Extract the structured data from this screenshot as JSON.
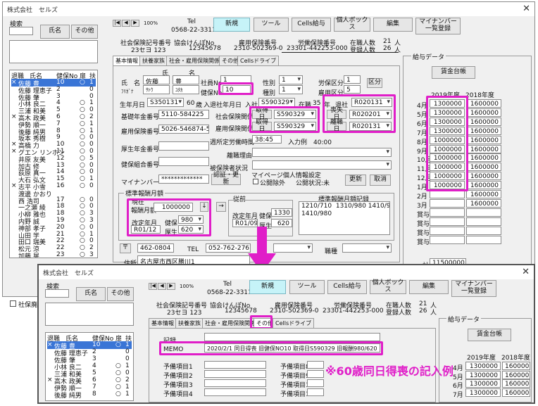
{
  "window": {
    "title": "株式会社　セルズ",
    "close_glyph": "✕"
  },
  "search": {
    "label": "検索",
    "name_button": "氏名",
    "other_button": "その他"
  },
  "nav": {
    "first": "|◀",
    "prev": "◀",
    "next": "▶",
    "last": "▶|",
    "zoom": "100%"
  },
  "tel": {
    "label": "Tel",
    "value": "0568-22-3311"
  },
  "toolbar": {
    "new": "新規",
    "tools": "ツール",
    "cells_payroll": "Cells給与",
    "personal_box": "個人ボックス",
    "edit": "編集",
    "mynumber": "マイナンバー\n一覧登録"
  },
  "insurance": {
    "social_no_label": "社会保険記号番号",
    "social_no": "23セヨ 123",
    "kyokai_label": "協会けんぽNo",
    "kyokai_no": "12345678",
    "employment_label": "雇用保険番号",
    "employment_no": "2310-502369-0",
    "labor_label": "労働保険番号",
    "labor_no": "23301-442253-000",
    "enrolled_label": "在職人数",
    "enrolled": "21",
    "registered_label": "登録人数",
    "registered": "26",
    "unit": "人"
  },
  "employee_list": {
    "headers": [
      "退職",
      "氏名",
      "健保No",
      "扉",
      "扶"
    ],
    "rows": [
      [
        "×",
        "佐藤 豊",
        "10",
        "○",
        "1"
      ],
      [
        "",
        "佐藤 理恵子",
        "2",
        "",
        "0"
      ],
      [
        "",
        "佐藤 肇",
        "3",
        "",
        "0"
      ],
      [
        "",
        "小林 良二",
        "4",
        "○",
        "1"
      ],
      [
        "",
        "三浦 和美",
        "5",
        "○",
        "0"
      ],
      [
        "×",
        "高木 政美",
        "6",
        "○",
        "2"
      ],
      [
        "",
        "伊勢 順一",
        "7",
        "○",
        "1"
      ],
      [
        "",
        "後藤 純男",
        "8",
        "○",
        "1"
      ],
      [
        "",
        "坂本 秀樹",
        "9",
        "○",
        "0"
      ],
      [
        "×",
        "高橋 力",
        "10",
        "○",
        "0"
      ],
      [
        "×",
        "グエン リンホン",
        "11",
        "○",
        "0"
      ],
      [
        "",
        "井原 友美",
        "12",
        "○",
        "5"
      ],
      [
        "",
        "加古 修",
        "13",
        "○",
        "0"
      ],
      [
        "",
        "荻原 真一",
        "14",
        "○",
        "0"
      ],
      [
        "",
        "大石 弘文",
        "15",
        "○",
        "1"
      ],
      [
        "×",
        "志平 小雪",
        "16",
        "○",
        "0"
      ],
      [
        "",
        "渡邊 かおり",
        "",
        "",
        ""
      ],
      [
        "",
        "西 浩司",
        "17",
        "○",
        "0"
      ],
      [
        "",
        "一之瀬 綾",
        "18",
        "○",
        "0"
      ],
      [
        "",
        "小柳 雅也",
        "18",
        "○",
        "3"
      ],
      [
        "",
        "内野 誠",
        "19",
        "○",
        "3"
      ],
      [
        "",
        "神部 孝子",
        "20",
        "○",
        "0"
      ],
      [
        "",
        "山田 学",
        "21",
        "○",
        "1"
      ],
      [
        "",
        "田口 瑞美",
        "22",
        "○",
        "0"
      ],
      [
        "",
        "松元 涼",
        "22",
        "○",
        "2"
      ],
      [
        "",
        "加藤 晃",
        "23",
        "○",
        "3"
      ]
    ],
    "retired_checkbox": "社保廃止"
  },
  "tabs1": [
    "基本情報",
    "扶養家族",
    "社会・雇用保険関係",
    "その他",
    "Cellsドライブ"
  ],
  "basic": {
    "name_label": "氏　名",
    "surname_header": "氏",
    "given_header": "名",
    "surname": "佐藤",
    "given": "豊",
    "furigana_label": "ﾌﾘｶﾞﾅ",
    "furi_surname": "ｻﾄｳ",
    "furi_given": "ﾕﾀｶ",
    "emp_no_label": "社員No",
    "emp_no": "1",
    "kenpo_no_label": "健保No",
    "kenpo_no": "10",
    "sex_label": "性別",
    "sex": "1",
    "kind_label": "種別",
    "kind": "1",
    "rouho_label": "労保区分",
    "rouho": "1",
    "koho_label": "雇用区分",
    "koho": "5",
    "kubun_button": "区分",
    "birth_label": "生年月日",
    "birth": "S350131",
    "age": "60",
    "age_unit": "歳",
    "join_label": "入退社年月日",
    "join_in": "入社",
    "join": "S590329",
    "tenure_label": "在職",
    "tenure": "35",
    "tenure_unit": "年",
    "retire_label": "退社",
    "retire": "R020131",
    "pension_label": "基礎年金番号",
    "pension": "5110-584225",
    "shakai_label": "社会保険関係",
    "acquire_button": "取得日",
    "shakai_acquire": "S590329",
    "loss_button": "喪失日",
    "shakai_loss": "R020201",
    "koyou_ins_label": "雇用保険関係",
    "koyou_acquire": "S590329",
    "leave_button": "離職日",
    "koyou_leave": "R020131",
    "koyou_no_label": "雇用保険番号",
    "koyou_no": "5026-546874-5",
    "weekly_label": "週所定労働時間",
    "weekly": "38:45",
    "input_example": "入力例　40:00",
    "kousei_label": "厚生年金番号",
    "kousei": "",
    "rishoku_reason_label": "離職理由",
    "kenpo_kumiai_label": "健保組合番号",
    "hihoken_label": "被保険者状況",
    "mynumber_label": "マイナンバー",
    "mynumber_mask": "*************",
    "cert_button": "認証・更新",
    "mynumber_setting_label": "マイページ個人情報設定",
    "public_exclude": "公開除外",
    "public_status": "公開状況:未",
    "update_button": "更新",
    "cancel_button": "取消"
  },
  "standard": {
    "section_label": "標準報酬月額",
    "current_label": "現在",
    "monthly_label": "報酬月額",
    "monthly": "1000000",
    "revise_label": "改定年月",
    "kenpo_label": "健保",
    "kenpo_grade": "980",
    "revise": "R01/12",
    "kousei_label": "厚生",
    "kousei_grade": "620",
    "prev_label": "従前",
    "prev_revise_label": "改定年月",
    "prev_kenpo": "1330",
    "prev_revise": "R01/09",
    "prev_kousei": "620",
    "history_label": "標準報酬月額記録",
    "history": "1210/710  1310/980 1410/980\n1410/980"
  },
  "address": {
    "zip_button": "〒",
    "zip": "462-0804",
    "tel_label": "TEL",
    "tel": "052-762-2767",
    "job_label": "職種",
    "addr_label": "住所",
    "addr": "名古屋市西区勝川1"
  },
  "payroll": {
    "section_label": "給与データ",
    "ledger_button": "賃金台帳",
    "year1": "2019年度",
    "year2": "2018年度",
    "rows": [
      [
        "4月",
        "1300000",
        "1600000"
      ],
      [
        "5月",
        "1300000",
        "1600000"
      ],
      [
        "6月",
        "1300000",
        "1600000"
      ],
      [
        "7月",
        "1300000",
        "1600000"
      ],
      [
        "8月",
        "1000000",
        "1600000"
      ],
      [
        "9月",
        "1000000",
        "1600000"
      ],
      [
        "10月",
        "1000000",
        "1600000"
      ],
      [
        "11月",
        "1000000",
        "1600000"
      ],
      [
        "12月",
        "1000000",
        "1600000"
      ],
      [
        "1月",
        "1000000",
        "1600000"
      ],
      [
        "2月",
        "",
        "1600000"
      ],
      [
        "3月",
        "",
        "1600000"
      ],
      [
        "賞与1",
        "",
        ""
      ],
      [
        "賞与2",
        "",
        ""
      ],
      [
        "賞与3",
        "",
        ""
      ],
      [
        "賞与4",
        "",
        ""
      ]
    ],
    "total_label": "計",
    "total": "11500000"
  },
  "second": {
    "tabs": [
      "基本情報",
      "扶養家族",
      "社会・雇用保険関係",
      "その他",
      "Cellsドライブ"
    ],
    "record_label": "記録",
    "memo_label": "MEMO",
    "memo": "2020/2/1 同日得喪 旧健保NO10 取得日S590329 旧報酬980/620",
    "spare_left": [
      "予備項目1",
      "予備項目2",
      "予備項目3",
      "予備項目4"
    ],
    "spare_right": [
      "予備項目8",
      "予備項目9",
      "予備項目10",
      "予備項目11"
    ],
    "annotation": "※60歳同日得喪の記入例",
    "emp_rows": [
      [
        "×",
        "佐藤 豊",
        "10",
        "○",
        "1"
      ],
      [
        "",
        "佐藤 理恵子",
        "2",
        "",
        "0"
      ],
      [
        "",
        "佐藤 肇",
        "3",
        "",
        "0"
      ],
      [
        "",
        "小林 良二",
        "4",
        "○",
        "1"
      ],
      [
        "",
        "三浦 和美",
        "5",
        "○",
        "0"
      ],
      [
        "×",
        "高木 政美",
        "6",
        "○",
        "2"
      ],
      [
        "",
        "伊勢 順一",
        "7",
        "○",
        "1"
      ],
      [
        "",
        "後藤 純男",
        "8",
        "○",
        "1"
      ]
    ],
    "payroll_rows": [
      [
        "4月",
        "1300000",
        "1600000"
      ],
      [
        "5月",
        "1300000",
        "1600000"
      ],
      [
        "6月",
        "1300000",
        "1600000"
      ],
      [
        "7月",
        "1300000",
        "1600000"
      ]
    ]
  },
  "colors": {
    "highlight": "#e01ec8",
    "selection": "#3a75d6",
    "cyan_button": "#c6f3f8"
  }
}
